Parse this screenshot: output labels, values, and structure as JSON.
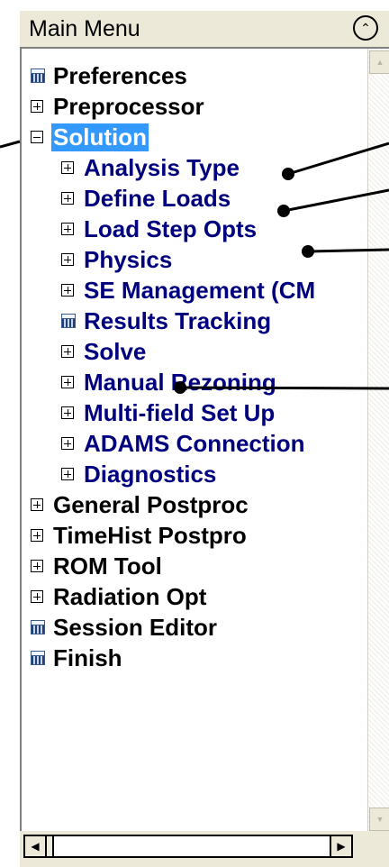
{
  "panel": {
    "title": "Main Menu",
    "collapse_icon": "double-chevron-up-icon"
  },
  "tree": {
    "items": [
      {
        "label": "Preferences",
        "icon": "calculator-icon"
      },
      {
        "label": "Preprocessor",
        "icon": "expand-plus-icon"
      },
      {
        "label": "Solution",
        "icon": "collapse-minus-icon",
        "selected": true
      },
      {
        "label": "Analysis Type",
        "icon": "expand-plus-icon"
      },
      {
        "label": "Define Loads",
        "icon": "expand-plus-icon"
      },
      {
        "label": "Load Step Opts",
        "icon": "expand-plus-icon"
      },
      {
        "label": "Physics",
        "icon": "expand-plus-icon"
      },
      {
        "label": "SE Management (CM",
        "icon": "expand-plus-icon"
      },
      {
        "label": "Results Tracking",
        "icon": "calculator-icon"
      },
      {
        "label": "Solve",
        "icon": "expand-plus-icon"
      },
      {
        "label": "Manual Rezoning",
        "icon": "expand-plus-icon"
      },
      {
        "label": "Multi-field Set Up",
        "icon": "expand-plus-icon"
      },
      {
        "label": "ADAMS Connection",
        "icon": "expand-plus-icon"
      },
      {
        "label": "Diagnostics",
        "icon": "expand-plus-icon"
      },
      {
        "label": "General Postproc",
        "icon": "expand-plus-icon"
      },
      {
        "label": "TimeHist Postpro",
        "icon": "expand-plus-icon"
      },
      {
        "label": "ROM Tool",
        "icon": "expand-plus-icon"
      },
      {
        "label": "Radiation Opt",
        "icon": "expand-plus-icon"
      },
      {
        "label": "Session Editor",
        "icon": "calculator-icon"
      },
      {
        "label": "Finish",
        "icon": "calculator-icon"
      }
    ]
  },
  "colors": {
    "panel_background": "#ece9d8",
    "top_level_text": "#000000",
    "child_text": "#00007f",
    "selection_background": "#3399ff",
    "selection_text": "#ffffff"
  }
}
